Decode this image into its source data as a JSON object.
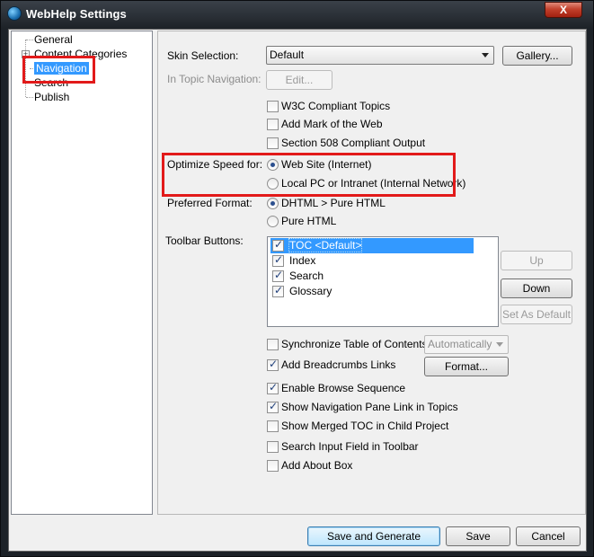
{
  "window": {
    "title": "WebHelp Settings",
    "close_label": "X"
  },
  "tree": {
    "items": [
      {
        "label": "General"
      },
      {
        "label": "Content Categories"
      },
      {
        "label": "Navigation"
      },
      {
        "label": "Search"
      },
      {
        "label": "Publish"
      }
    ]
  },
  "form": {
    "skin_label": "Skin Selection:",
    "skin_value": "Default",
    "gallery_label": "Gallery...",
    "in_topic_label": "In Topic Navigation:",
    "edit_label": "Edit...",
    "w3c_label": "W3C Compliant Topics",
    "w3c_checked": false,
    "mark_label": "Add Mark of the Web",
    "mark_checked": false,
    "s508_label": "Section 508 Compliant Output",
    "s508_checked": false,
    "optimize_label": "Optimize Speed for:",
    "optimize_options": [
      "Web Site (Internet)",
      "Local PC or Intranet (Internal Network)"
    ],
    "optimize_selected": "Web Site (Internet)",
    "format_label": "Preferred Format:",
    "format_options": [
      "DHTML > Pure HTML",
      "Pure HTML"
    ],
    "format_selected": "DHTML > Pure HTML",
    "toolbar_label": "Toolbar Buttons:",
    "toolbar_items": [
      {
        "label": "TOC <Default>",
        "checked": true
      },
      {
        "label": "Index",
        "checked": true
      },
      {
        "label": "Search",
        "checked": true
      },
      {
        "label": "Glossary",
        "checked": true
      }
    ],
    "up_label": "Up",
    "down_label": "Down",
    "set_default_label": "Set As Default",
    "sync_label": "Synchronize Table of Contents",
    "sync_checked": false,
    "sync_combo": "Automatically",
    "breadcrumbs_label": "Add Breadcrumbs Links",
    "breadcrumbs_checked": true,
    "format_btn_label": "Format...",
    "browse_label": "Enable Browse Sequence",
    "browse_checked": true,
    "navpane_label": "Show Navigation Pane Link in Topics",
    "navpane_checked": true,
    "merged_label": "Show Merged TOC in Child Project",
    "merged_checked": false,
    "searchfield_label": "Search Input Field in Toolbar",
    "searchfield_checked": false,
    "about_label": "Add About Box",
    "about_checked": false
  },
  "footer": {
    "save_generate_label": "Save and Generate",
    "save_label": "Save",
    "cancel_label": "Cancel"
  },
  "colors": {
    "highlight_box": "#e21a1a",
    "selection": "#3399ff"
  }
}
